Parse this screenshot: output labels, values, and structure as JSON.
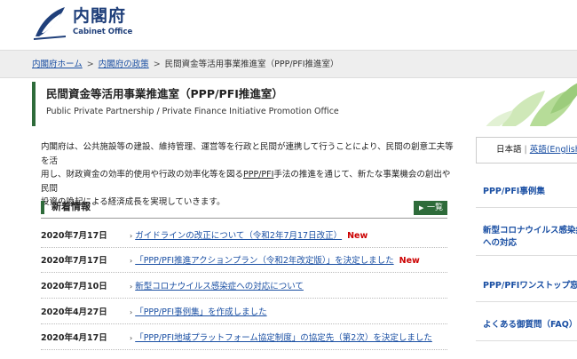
{
  "header": {
    "logo_jp": "内閣府",
    "logo_en": "Cabinet Office"
  },
  "breadcrumb": {
    "home": "内閣府ホーム",
    "policy": "内閣府の政策",
    "current": "民間資金等活用事業推進室（PPP/PFI推進室）",
    "separator": ">"
  },
  "page": {
    "title_jp": "民間資金等活用事業推進室（PPP/PFI推進室）",
    "title_en": "Public Private Partnership / Private Finance Initiative Promotion Office"
  },
  "intro": {
    "line1": "内閣府は、公共施設等の建設、維持管理、運営等を行政と民間が連携して行うことにより、民間の創意工夫等を活",
    "line2_pre": "用し、財政資金の効率的使用や行政の効率化等を図る",
    "line2_link": "PPP/PFI",
    "line2_post": "手法の推進を通じて、新たな事業機会の創出や民間",
    "line3": "投資の喚起による経済成長を実現していきます。"
  },
  "news": {
    "title": "新着情報",
    "list_button": "一覧",
    "new_label": "New",
    "items": [
      {
        "date": "2020年7月17日",
        "text": "ガイドラインの改正について（令和2年7月17日改正）",
        "is_new": true
      },
      {
        "date": "2020年7月17日",
        "text": "「PPP/PFI推進アクションプラン（令和2年改定版）」を決定しました",
        "is_new": true
      },
      {
        "date": "2020年7月10日",
        "text": "新型コロナウイルス感染症への対応について",
        "is_new": false
      },
      {
        "date": "2020年4月27日",
        "text": "「PPP/PFI事例集」を作成しました",
        "is_new": false
      },
      {
        "date": "2020年4月17日",
        "text": "「PPP/PFI地域プラットフォーム協定制度」の協定先（第2次）を決定しました",
        "is_new": false
      }
    ]
  },
  "sidebar": {
    "lang_current": "日本語",
    "lang_separator": "|",
    "lang_english": "英語(English)",
    "items": [
      {
        "label1": "PPP/PFI事例集",
        "label2": ""
      },
      {
        "label1": "新型コロナウイルス感染症",
        "label2": "への対応"
      },
      {
        "label1": "PPP/PFIワンストップ窓口",
        "label2": ""
      },
      {
        "label1": "よくある御質問（FAQ）",
        "label2": ""
      }
    ]
  },
  "colors": {
    "brand_green": "#2e6b3a",
    "link_blue": "#1a4fa3",
    "new_red": "#cc0000"
  }
}
